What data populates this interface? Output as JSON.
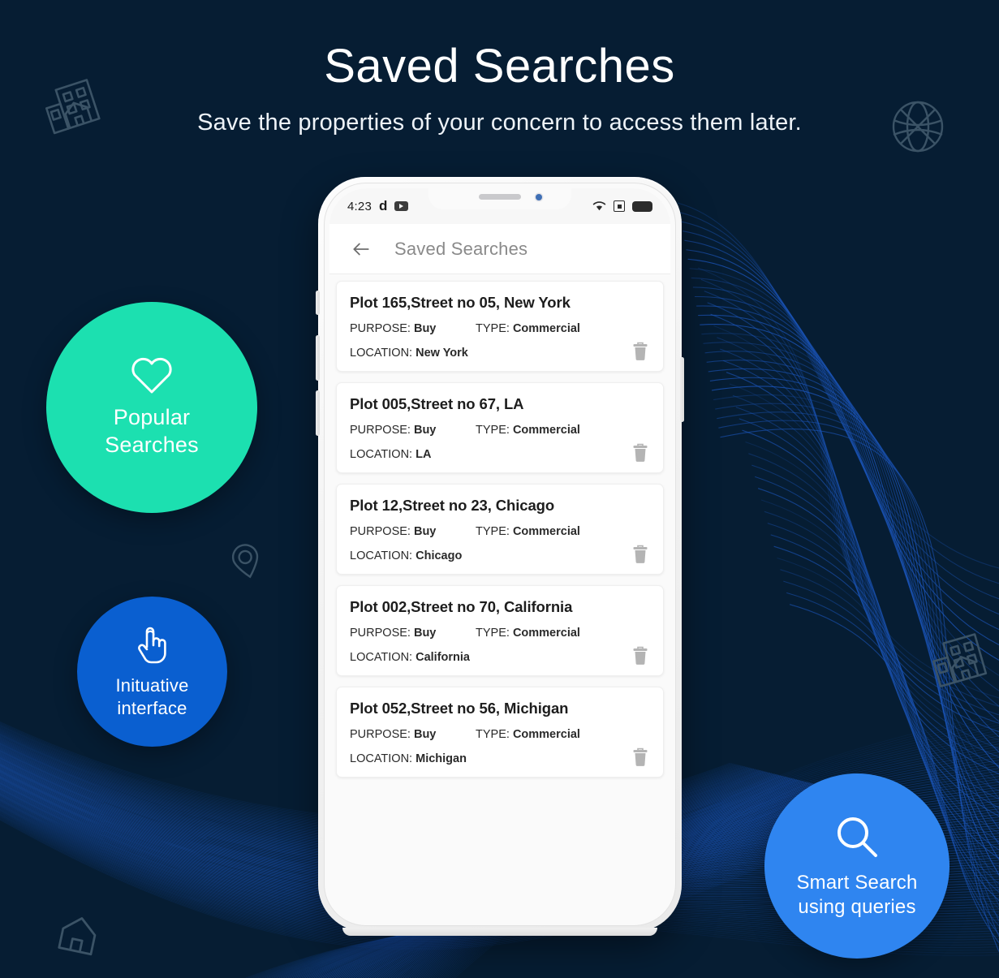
{
  "page": {
    "background_color": "#061d33",
    "title": "Saved Searches",
    "subtitle": "Save the properties of your concern to access them later."
  },
  "decorative_icons": [
    {
      "name": "building-outline-icon",
      "position": "top-left"
    },
    {
      "name": "globe-outline-icon",
      "position": "top-right"
    },
    {
      "name": "map-pin-outline-icon",
      "position": "mid-left"
    },
    {
      "name": "building-outline-icon",
      "position": "mid-right"
    },
    {
      "name": "house-outline-icon",
      "position": "bottom-left"
    }
  ],
  "badges": [
    {
      "id": "popular",
      "icon": "heart-icon",
      "label_line1": "Popular",
      "label_line2": "Searches",
      "color": "#1ce0b0"
    },
    {
      "id": "intuitive",
      "icon": "pointing-hand-icon",
      "label_line1": "Inituative",
      "label_line2": "interface",
      "color": "#0a5fd0"
    },
    {
      "id": "smart",
      "icon": "search-icon",
      "label_line1": "Smart Search",
      "label_line2": "using queries",
      "color": "#2f85f0"
    }
  ],
  "phone": {
    "status_bar": {
      "time": "4:23",
      "app_badge": "d",
      "media_icon": "youtube-icon",
      "wifi_icon": "wifi-icon",
      "sim_icon": "sim-icon",
      "battery_icon": "battery-full-icon"
    },
    "appbar": {
      "back_icon": "back-arrow-icon",
      "title": "Saved Searches"
    },
    "labels": {
      "purpose": "PURPOSE:",
      "type": "TYPE:",
      "location": "LOCATION:",
      "delete_icon": "trash-icon"
    },
    "saved_searches": [
      {
        "title": "Plot 165,Street no 05, New York",
        "purpose": "Buy",
        "type": "Commercial",
        "location": "New York"
      },
      {
        "title": "Plot 005,Street no 67, LA",
        "purpose": "Buy",
        "type": "Commercial",
        "location": "LA"
      },
      {
        "title": "Plot 12,Street no 23, Chicago",
        "purpose": "Buy",
        "type": "Commercial",
        "location": "Chicago"
      },
      {
        "title": "Plot 002,Street no 70, California",
        "purpose": "Buy",
        "type": "Commercial",
        "location": "California"
      },
      {
        "title": "Plot 052,Street no 56, Michigan",
        "purpose": "Buy",
        "type": "Commercial",
        "location": "Michigan"
      }
    ]
  }
}
